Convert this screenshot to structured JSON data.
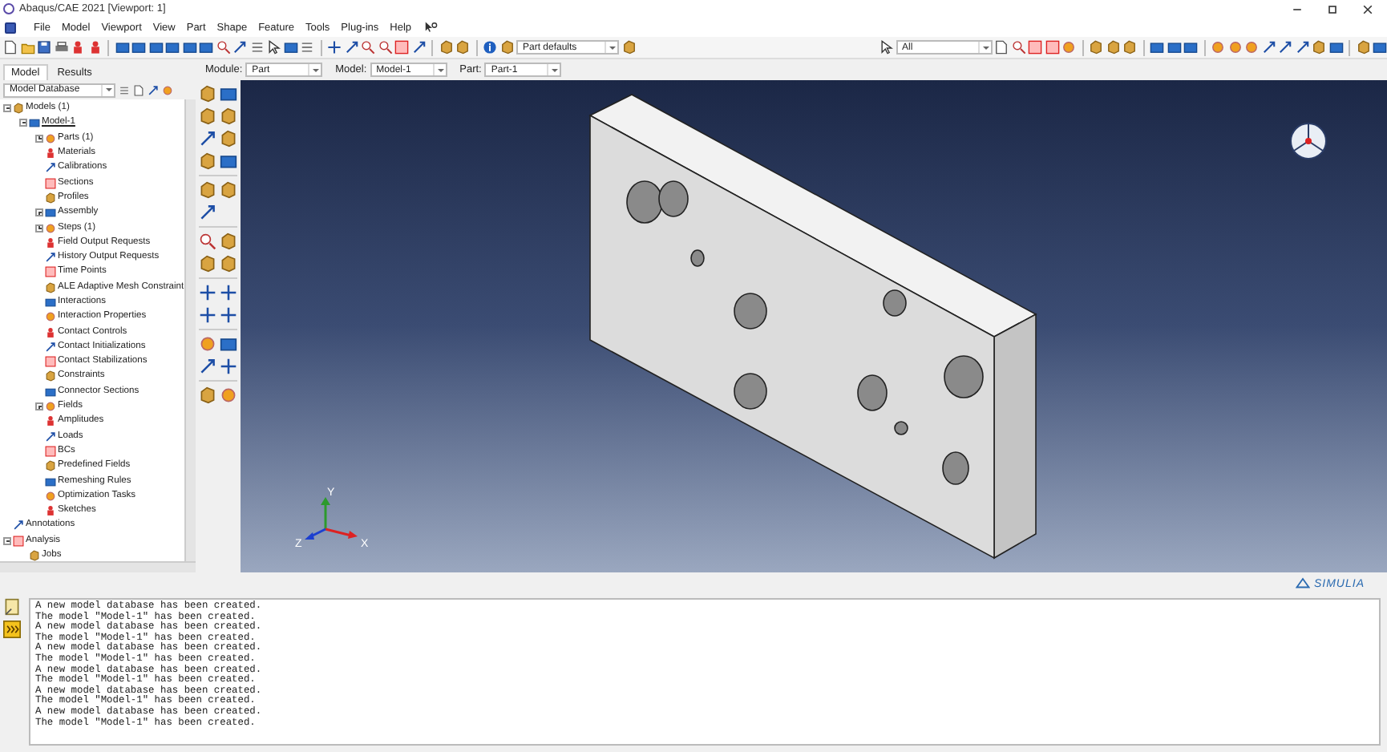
{
  "window": {
    "title": "Abaqus/CAE 2021 [Viewport: 1]"
  },
  "menu": [
    "File",
    "Model",
    "Viewport",
    "View",
    "Part",
    "Shape",
    "Feature",
    "Tools",
    "Plug-ins",
    "Help"
  ],
  "toolbar": {
    "render_style": "Part defaults",
    "selection_filter": "All"
  },
  "tabs": [
    {
      "label": "Model",
      "selected": true
    },
    {
      "label": "Results",
      "selected": false
    }
  ],
  "context": [
    {
      "label": "Module:",
      "value": "Part"
    },
    {
      "label": "Model:",
      "value": "Model-1"
    },
    {
      "label": "Part:",
      "value": "Part-1"
    }
  ],
  "model_tree": {
    "source": "Model Database",
    "items": [
      {
        "label": "Models (1)",
        "expanded": true,
        "children": [
          {
            "label": "Model-1",
            "expanded": true,
            "current": true,
            "children": [
              {
                "label": "Parts (1)",
                "expanded": false
              },
              {
                "label": "Materials"
              },
              {
                "label": "Calibrations"
              },
              {
                "label": "Sections"
              },
              {
                "label": "Profiles"
              },
              {
                "label": "Assembly",
                "expanded": false
              },
              {
                "label": "Steps (1)",
                "expanded": false
              },
              {
                "label": "Field Output Requests"
              },
              {
                "label": "History Output Requests"
              },
              {
                "label": "Time Points"
              },
              {
                "label": "ALE Adaptive Mesh Constraint"
              },
              {
                "label": "Interactions"
              },
              {
                "label": "Interaction Properties"
              },
              {
                "label": "Contact Controls"
              },
              {
                "label": "Contact Initializations"
              },
              {
                "label": "Contact Stabilizations"
              },
              {
                "label": "Constraints"
              },
              {
                "label": "Connector Sections"
              },
              {
                "label": "Fields",
                "expanded": false
              },
              {
                "label": "Amplitudes"
              },
              {
                "label": "Loads"
              },
              {
                "label": "BCs"
              },
              {
                "label": "Predefined Fields"
              },
              {
                "label": "Remeshing Rules"
              },
              {
                "label": "Optimization Tasks"
              },
              {
                "label": "Sketches"
              }
            ]
          }
        ]
      },
      {
        "label": "Annotations"
      },
      {
        "label": "Analysis",
        "expanded": true,
        "children": [
          {
            "label": "Jobs"
          }
        ]
      }
    ]
  },
  "viewport": {
    "axes": {
      "x": "X",
      "y": "Y",
      "z": "Z"
    },
    "logo": "SIMULIA"
  },
  "messages": [
    "A new model database has been created.",
    "The model \"Model-1\" has been created.",
    "A new model database has been created.",
    "The model \"Model-1\" has been created.",
    "A new model database has been created.",
    "The model \"Model-1\" has been created.",
    "A new model database has been created.",
    "The model \"Model-1\" has been created.",
    "A new model database has been created.",
    "The model \"Model-1\" has been created.",
    "A new model database has been created.",
    "The model \"Model-1\" has been created."
  ]
}
